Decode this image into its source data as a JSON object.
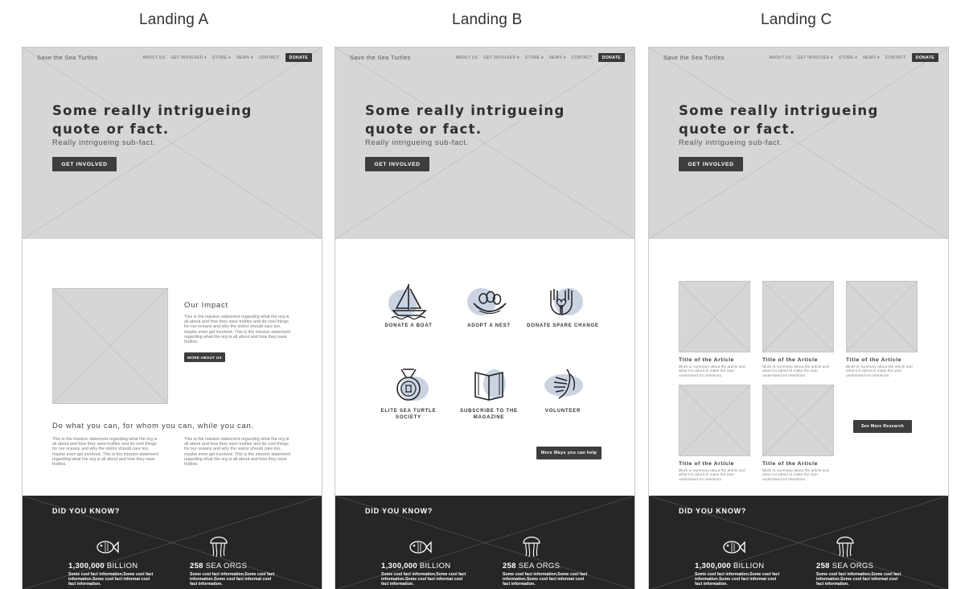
{
  "columns": [
    {
      "title": "Landing A"
    },
    {
      "title": "Landing B"
    },
    {
      "title": "Landing C"
    }
  ],
  "nav": {
    "brand": "Save the Sea Turtles",
    "links": [
      "ABOUT US",
      "GET INVOLVED ▾",
      "STORE ▾",
      "NEWS ▾",
      "CONTACT"
    ],
    "donate": "DONATE"
  },
  "hero": {
    "title": "Some really intrigueing quote or fact.",
    "subtitle": "Really intrigueing sub-fact.",
    "button": "GET INVOLVED"
  },
  "landing_a": {
    "impact_heading": "Our Impact",
    "impact_body": "This is the mission statement regarding what the org is all about and how they save truttles and do cool things for our oceans and why the visitor should care too, maybe even get involved. This is the mission statement regarding what the org is all about and how they save truttles.",
    "more_button": "MORE ABOUT US",
    "doing_heading": "Do what you can, for whom you can, while you can.",
    "doing_body_left": "This is the mission statement regarding what the org is all about and how they save truttles and do cool things for our oceans and why the visitor should care too, maybe even get involved. This is the mission statement regarding what the org is all about and how they save truttles.",
    "doing_body_right": "This is the mission statement regarding what the org is all about and how they save truttles and do cool things for our oceans and why the visitor should care too, maybe even get involved. This is the mission statement regarding what the org is all about and how they save truttles."
  },
  "landing_b": {
    "ways": [
      {
        "label": "DONATE A BOAT",
        "icon": "sailboat-icon"
      },
      {
        "label": "ADOPT A NEST",
        "icon": "nest-icon"
      },
      {
        "label": "DONATE SPARE CHANGE",
        "icon": "hands-heart-icon"
      },
      {
        "label": "ELITE SEA TURTLE SOCIETY",
        "icon": "medal-icon"
      },
      {
        "label": "SUBSCRIBE TO THE MAGAZINE",
        "icon": "book-icon"
      },
      {
        "label": "VOLUNTEER",
        "icon": "raised-hand-icon"
      }
    ],
    "more_button": "More Ways you can help",
    "blob_color": "#c9d3e2"
  },
  "landing_c": {
    "articles": [
      {
        "title": "Title of the Article",
        "blurb": "Blurb or summary about the article and what it is about to make the user understand it's intentions."
      },
      {
        "title": "Title of the Article",
        "blurb": "Blurb or summary about the article and what it is about to make the user understand it's intentions."
      },
      {
        "title": "Title of the Article",
        "blurb": "Blurb or summary about the article and what it is about to make the user understand it's intentions."
      },
      {
        "title": "Title of the Article",
        "blurb": "Blurb or summary about the article and what it is about to make the user understand it's intentions."
      },
      {
        "title": "Title of the Article",
        "blurb": "Blurb or summary about the article and what it is about to make the user understand it's intentions."
      }
    ],
    "more_button": "See More Research"
  },
  "did_you_know": {
    "heading": "DID YOU KNOW?",
    "stats": [
      {
        "number": "1,300,000",
        "unit": "BILLION",
        "desc": "Some cool fact information.Some cool fact information.Some cool fact informat cool fact information.",
        "icon": "fish-icon"
      },
      {
        "number": "258",
        "unit": "SEA ORGS",
        "desc": "Some cool fact information.Some cool fact information.Some cool fact informat cool fact information.",
        "icon": "jellyfish-icon"
      }
    ]
  },
  "colors": {
    "placeholder": "#d6d6d6",
    "dark": "#262626",
    "button": "#3d3d3d"
  }
}
